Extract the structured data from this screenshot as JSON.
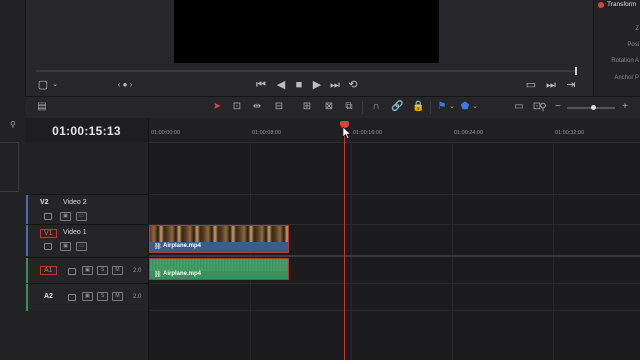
{
  "viewer": {
    "nav_indicator": "‹ ● ›",
    "transport": [
      "skip-to-start-icon",
      "prev-frame-icon",
      "stop-icon",
      "play-icon",
      "skip-to-end-icon",
      "loop-icon"
    ]
  },
  "inspector": {
    "title": "Transform",
    "labels": [
      "Z",
      "Posi",
      "Rotation A",
      "Anchor P"
    ]
  },
  "timeline": {
    "timecode": "01:00:15:13",
    "ruler_labels": [
      "01:00:00:00",
      "01:00:08:00",
      "01:00:16:00",
      "01:00:24:00",
      "01:00:32:00"
    ]
  },
  "tracks": {
    "v2": {
      "id": "V2",
      "name": "Video 2"
    },
    "v1": {
      "id": "V1",
      "name": "Video 1"
    },
    "a1": {
      "id": "A1",
      "level": "2.0",
      "solo": "S",
      "mute": "M"
    },
    "a2": {
      "id": "A2",
      "level": "2.0",
      "solo": "S",
      "mute": "M"
    }
  },
  "clips": {
    "video": {
      "name": "Airplane.mp4"
    },
    "audio": {
      "name": "Airplane.mp4"
    }
  },
  "colors": {
    "playhead": "#d9443a",
    "video_clip": "#3d5d84",
    "audio_clip": "#3a8f5c",
    "selection_border": "#b33a2f"
  }
}
